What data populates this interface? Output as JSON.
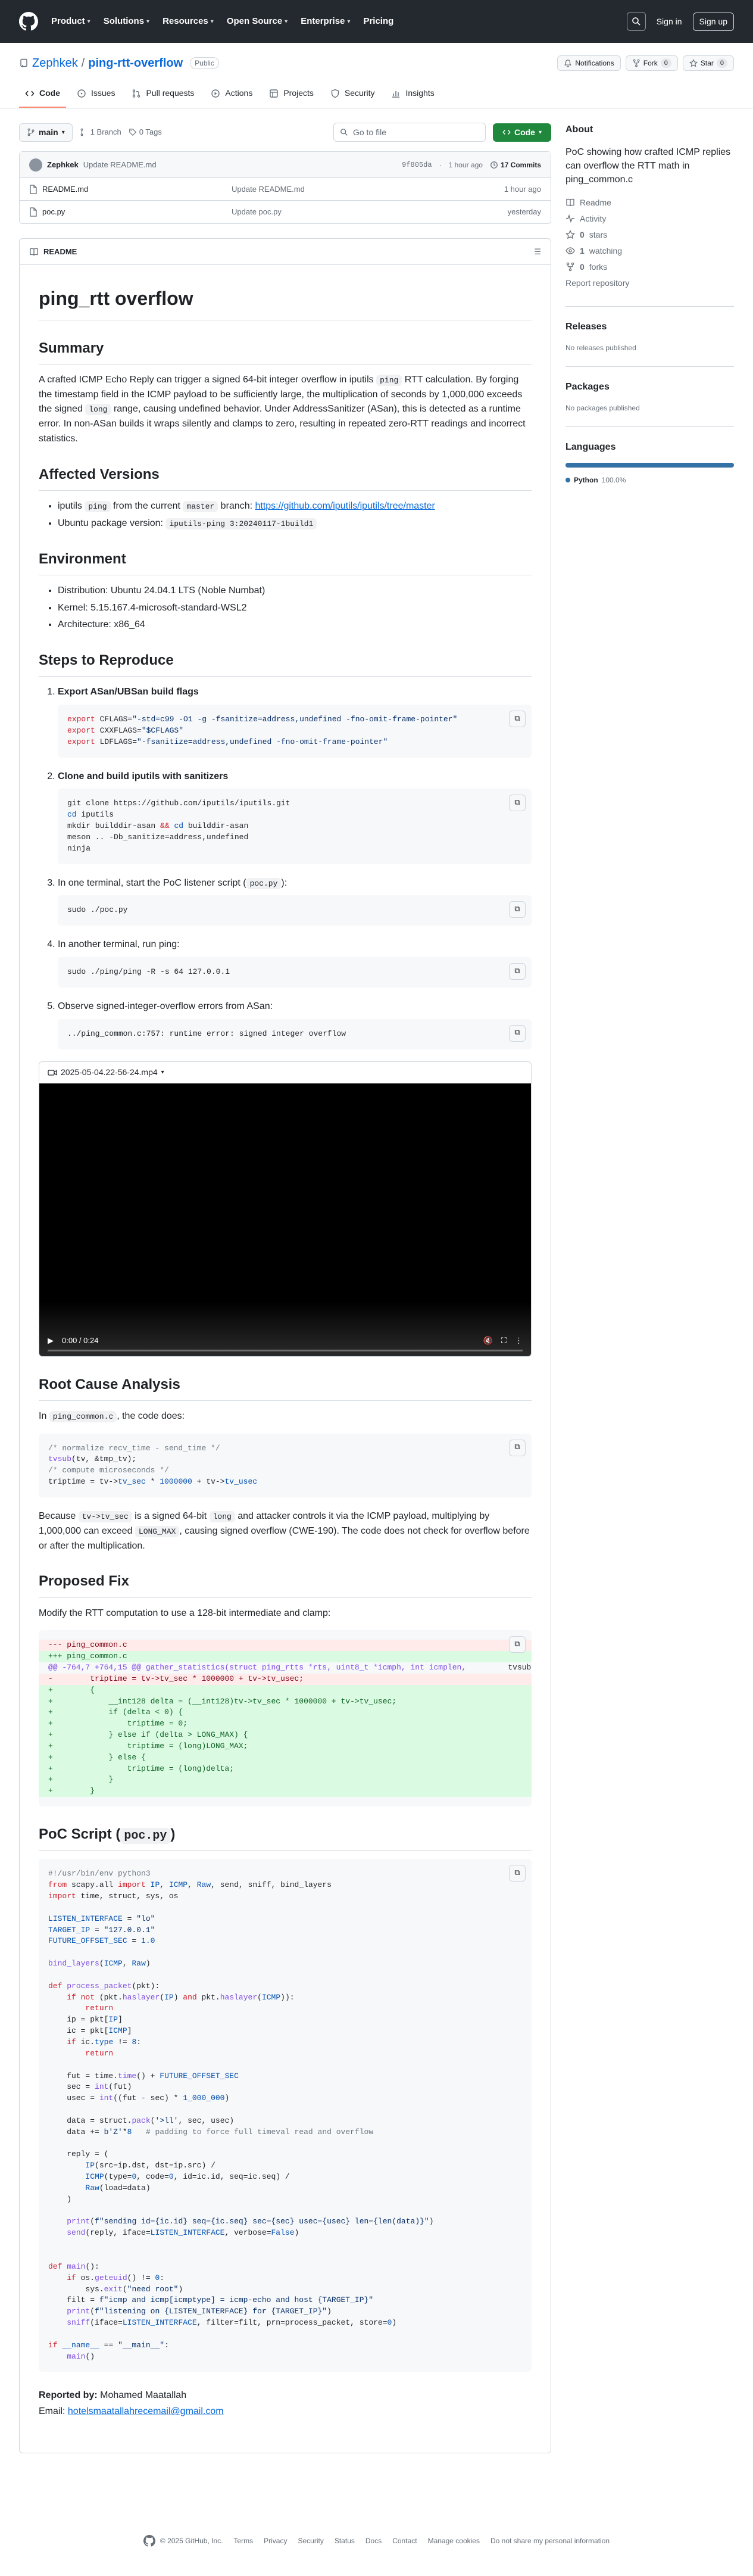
{
  "header": {
    "nav": [
      "Product",
      "Solutions",
      "Resources",
      "Open Source",
      "Enterprise",
      "Pricing"
    ],
    "sign_in": "Sign in",
    "sign_up": "Sign up"
  },
  "repo": {
    "owner": "Zephkek",
    "name": "ping-rtt-overflow",
    "visibility": "Public",
    "notifications": "Notifications",
    "fork_label": "Fork",
    "fork_count": "0",
    "star_label": "Star",
    "star_count": "0",
    "tabs": [
      "Code",
      "Issues",
      "Pull requests",
      "Actions",
      "Projects",
      "Security",
      "Insights"
    ]
  },
  "file_nav": {
    "branch": "main",
    "branches": "1 Branch",
    "tags": "0 Tags",
    "goto_placeholder": "Go to file",
    "code_button": "Code"
  },
  "commit": {
    "author": "Zephkek",
    "message": "Update README.md",
    "hash": "9f805da",
    "time": "1 hour ago",
    "commits": "17 Commits"
  },
  "files": [
    {
      "name": "README.md",
      "message": "Update README.md",
      "time": "1 hour ago"
    },
    {
      "name": "poc.py",
      "message": "Update poc.py",
      "time": "yesterday"
    }
  ],
  "readme": {
    "tab_label": "README",
    "title": "ping_rtt overflow",
    "summary_heading": "Summary",
    "summary_p1": "A crafted ICMP Echo Reply can trigger a signed 64-bit integer overflow in iputils ",
    "summary_code1": "ping",
    "summary_p2": " RTT calculation. By forging the timestamp field in the ICMP payload to be sufficiently large, the multiplication of seconds by 1,000,000 exceeds the signed ",
    "summary_code2": "long",
    "summary_p3": " range, causing undefined behavior. Under AddressSanitizer (ASan), this is detected as a runtime error. In non-ASan builds it wraps silently and clamps to zero, resulting in repeated zero-RTT readings and incorrect statistics.",
    "affected_heading": "Affected Versions",
    "affected_1a": "iputils ",
    "affected_1code": "ping",
    "affected_1b": " from the current ",
    "affected_1code2": "master",
    "affected_1c": " branch: ",
    "affected_1link": "https://github.com/iputils/iputils/tree/master",
    "affected_2a": "Ubuntu package version: ",
    "affected_2code": "iputils-ping 3:20240117-1build1",
    "env_heading": "Environment",
    "env_items": [
      "Distribution: Ubuntu 24.04.1 LTS (Noble Numbat)",
      "Kernel: 5.15.167.4-microsoft-standard-WSL2",
      "Architecture: x86_64"
    ],
    "steps_heading": "Steps to Reproduce",
    "step1": "Export ASan/UBSan build flags",
    "step2": "Clone and build iputils with sanitizers",
    "step3a": "In one terminal, start the PoC listener script (",
    "step3code": "poc.py",
    "step3b": "):",
    "step4": "In another terminal, run ping:",
    "step5": "Observe signed-integer-overflow errors from ASan:",
    "video_name": "2025-05-04.22-56-24.mp4",
    "video_time": "0:00 / 0:24",
    "rca_heading": "Root Cause Analysis",
    "rca_p_a": "In ",
    "rca_p_code": "ping_common.c",
    "rca_p_b": ", the code does:",
    "rca_p2_a": "Because ",
    "rca_p2_code1": "tv->tv_sec",
    "rca_p2_b": " is a signed 64-bit ",
    "rca_p2_code2": "long",
    "rca_p2_c": " and attacker controls it via the ICMP payload, multiplying by 1,000,000 can exceed ",
    "rca_p2_code3": "LONG_MAX",
    "rca_p2_d": ", causing signed overflow (CWE-190). The code does not check for overflow before or after the multiplication.",
    "fix_heading": "Proposed Fix",
    "fix_p": "Modify the RTT computation to use a 128-bit intermediate and clamp:",
    "poc_heading_a": "PoC Script (",
    "poc_heading_code": "poc.py",
    "poc_heading_b": ")",
    "reported_label": "Reported by:",
    "reported_name": " Mohamed Maatallah",
    "email_label": "Email: ",
    "email": "hotelsmaatallahrecemail@gmail.com"
  },
  "sidebar": {
    "about": "About",
    "description": "PoC showing how crafted ICMP replies can overflow the RTT math in ping_common.c",
    "readme": "Readme",
    "activity": "Activity",
    "stars": "0",
    "stars_label": "stars",
    "watching": "1",
    "watching_label": "watching",
    "forks": "0",
    "forks_label": "forks",
    "report": "Report repository",
    "releases": "Releases",
    "no_releases": "No releases published",
    "packages": "Packages",
    "no_packages": "No packages published",
    "languages": "Languages",
    "lang_name": "Python",
    "lang_pct": "100.0%"
  },
  "footer": {
    "copyright": "© 2025 GitHub, Inc.",
    "links": [
      "Terms",
      "Privacy",
      "Security",
      "Status",
      "Docs",
      "Contact",
      "Manage cookies",
      "Do not share my personal information"
    ]
  },
  "colors": {
    "header_bg": "#24292f",
    "accent": "#0969da",
    "code_btn": "#1f883d",
    "python": "#3572A5"
  }
}
